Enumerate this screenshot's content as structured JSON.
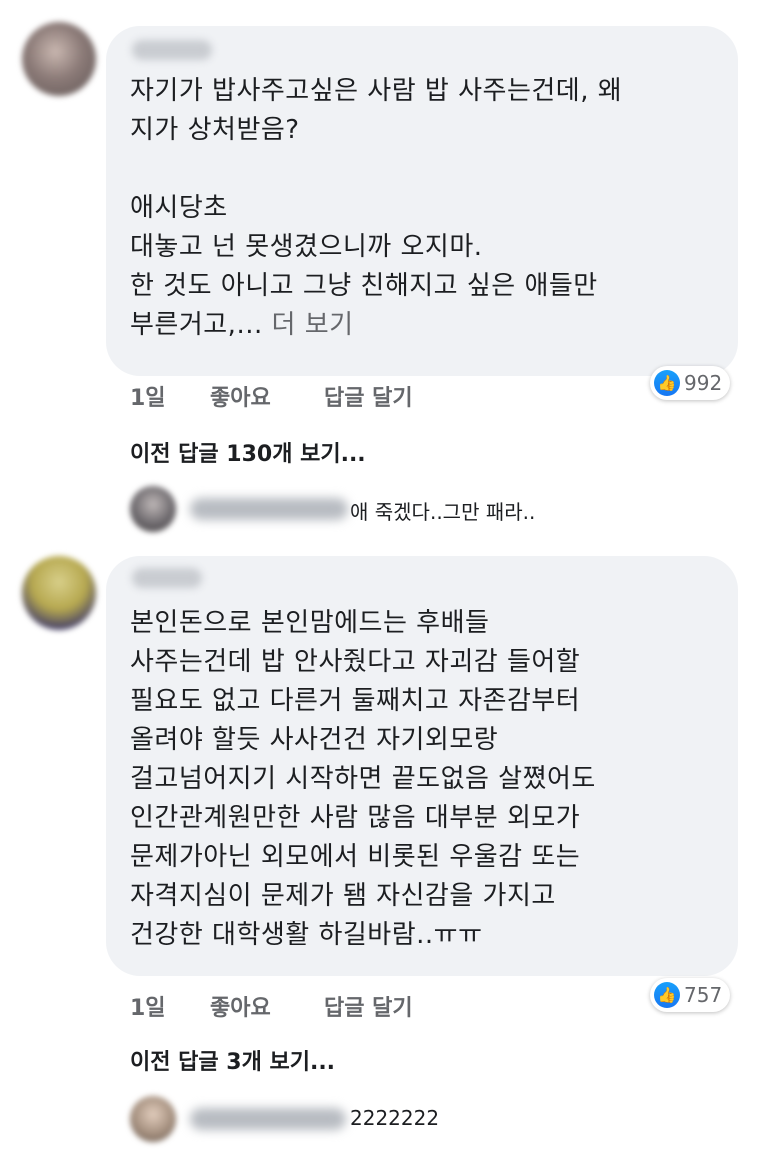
{
  "comments": [
    {
      "text": "자기가 밥사주고싶은 사람 밥 사주는건데, 왜\n지가 상처받음?\n\n애시당초\n대놓고 넌 못생겼으니까 오지마.\n한 것도 아니고 그냥 친해지고 싶은 애들만\n부른거고,...",
      "see_more": "더 보기",
      "time": "1일",
      "like_label": "좋아요",
      "reply_label": "답글 달기",
      "reaction_count": "992",
      "previous_replies": "이전 답글 130개 보기...",
      "reply_preview": "애 죽겠다..그만 패라.."
    },
    {
      "text": "본인돈으로 본인맘에드는 후배들\n사주는건데 밥 안사줬다고 자괴감 들어할\n필요도 없고 다른거 둘째치고 자존감부터\n올려야 할듯 사사건건 자기외모랑\n걸고넘어지기 시작하면 끝도없음 살쪘어도\n인간관계원만한 사람 많음 대부분 외모가\n문제가아닌 외모에서 비롯된 우울감 또는\n자격지심이 문제가 됌 자신감을 가지고\n건강한 대학생활 하길바람..ㅠㅠ",
      "time": "1일",
      "like_label": "좋아요",
      "reply_label": "답글 달기",
      "reaction_count": "757",
      "previous_replies": "이전 답글 3개 보기...",
      "reply_preview": "2222222"
    }
  ],
  "icons": {
    "like": "thumbs-up-icon"
  },
  "colors": {
    "bubble": "#f0f2f5",
    "like_blue": "#1877f2",
    "meta_gray": "#65676b"
  }
}
